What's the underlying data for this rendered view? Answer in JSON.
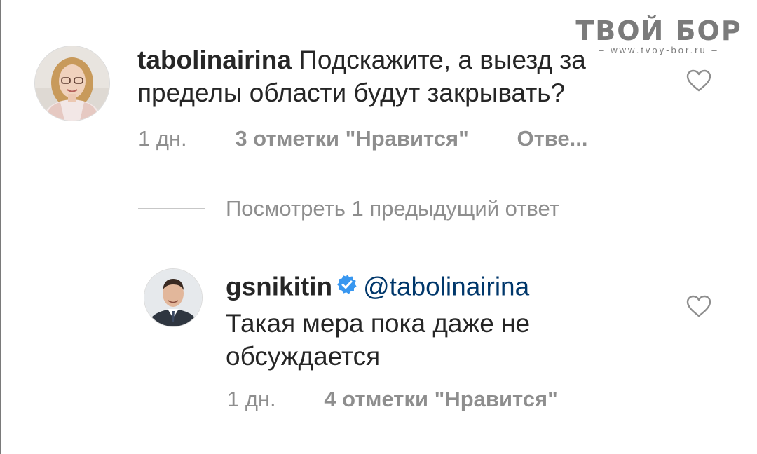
{
  "watermark": {
    "title": "ТВОЙ БОР",
    "url": "– www.tvoy-bor.ru –"
  },
  "comment1": {
    "username": "tabolinairina",
    "text_line1": "Подскажите, а выезд за",
    "text_line2": "пределы области будут закрывать?",
    "time": "1 дн.",
    "likes": "3 отметки \"Нравится\"",
    "reply": "Отве..."
  },
  "replies": {
    "view_previous": "Посмотреть 1 предыдущий ответ"
  },
  "comment2": {
    "username": "gsnikitin",
    "mention": "@tabolinairina",
    "text_line1": "Такая мера пока даже не",
    "text_line2": "обсуждается",
    "time": "1 дн.",
    "likes": "4 отметки \"Нравится\""
  },
  "icons": {
    "like": "heart-outline-icon",
    "verified": "verified-badge-icon"
  },
  "colors": {
    "verified": "#3897f0",
    "mention": "#00376b",
    "muted": "#8e8e8e"
  }
}
